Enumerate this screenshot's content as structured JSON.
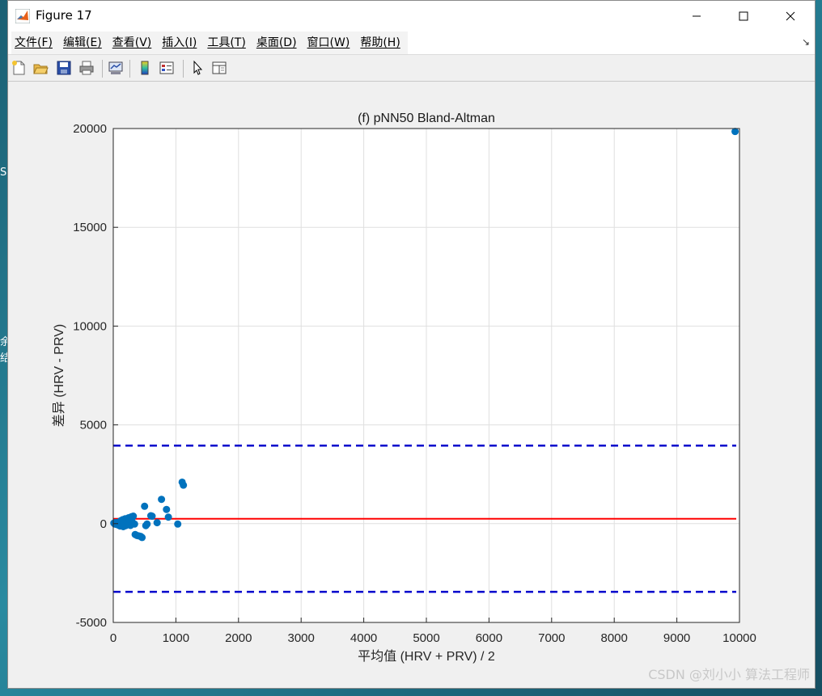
{
  "window": {
    "title": "Figure 17",
    "icon": "matlab-logo-icon"
  },
  "menu": [
    {
      "label": "文件(F)"
    },
    {
      "label": "编辑(E)"
    },
    {
      "label": "查看(V)"
    },
    {
      "label": "插入(I)"
    },
    {
      "label": "工具(T)"
    },
    {
      "label": "桌面(D)"
    },
    {
      "label": "窗口(W)"
    },
    {
      "label": "帮助(H)"
    }
  ],
  "menu_extra": "↘",
  "toolbar": [
    {
      "icon": "new-figure-icon"
    },
    {
      "icon": "open-file-icon"
    },
    {
      "icon": "save-icon"
    },
    {
      "icon": "print-icon"
    },
    {
      "icon": "link-plot-icon"
    },
    {
      "icon": "insert-colorbar-icon"
    },
    {
      "icon": "insert-legend-icon"
    },
    {
      "icon": "edit-plot-pointer-icon"
    },
    {
      "icon": "property-inspector-icon"
    }
  ],
  "desktop_fragments": [
    "S",
    "余",
    "结"
  ],
  "watermark": "CSDN @刘小小 算法工程师",
  "colors": {
    "points": "#0072BD",
    "mean_line": "#ff0000",
    "limit_lines": "#0000cc"
  },
  "chart_data": {
    "type": "scatter",
    "title": "(f) pNN50 Bland-Altman",
    "xlabel": "平均值 (HRV + PRV) / 2",
    "ylabel": "差异 (HRV - PRV)",
    "xlim": [
      0,
      10000
    ],
    "ylim": [
      -5000,
      20000
    ],
    "xticks": [
      0,
      1000,
      2000,
      3000,
      4000,
      5000,
      6000,
      7000,
      8000,
      9000,
      10000
    ],
    "yticks": [
      -5000,
      0,
      5000,
      10000,
      15000,
      20000
    ],
    "grid": true,
    "mean_diff": 250,
    "upper_loa": 3950,
    "lower_loa": -3450,
    "points": [
      {
        "x": 10,
        "y": 30
      },
      {
        "x": 25,
        "y": -20
      },
      {
        "x": 40,
        "y": 60
      },
      {
        "x": 55,
        "y": -40
      },
      {
        "x": 70,
        "y": 10
      },
      {
        "x": 85,
        "y": -80
      },
      {
        "x": 100,
        "y": 90
      },
      {
        "x": 110,
        "y": -120
      },
      {
        "x": 120,
        "y": 150
      },
      {
        "x": 135,
        "y": -60
      },
      {
        "x": 150,
        "y": 200
      },
      {
        "x": 160,
        "y": -150
      },
      {
        "x": 175,
        "y": 80
      },
      {
        "x": 190,
        "y": 250
      },
      {
        "x": 200,
        "y": -100
      },
      {
        "x": 215,
        "y": 120
      },
      {
        "x": 230,
        "y": -50
      },
      {
        "x": 245,
        "y": 300
      },
      {
        "x": 260,
        "y": 200
      },
      {
        "x": 275,
        "y": -90
      },
      {
        "x": 290,
        "y": 350
      },
      {
        "x": 300,
        "y": 100
      },
      {
        "x": 320,
        "y": 380
      },
      {
        "x": 340,
        "y": -20
      },
      {
        "x": 350,
        "y": -550
      },
      {
        "x": 380,
        "y": -600
      },
      {
        "x": 410,
        "y": -620
      },
      {
        "x": 440,
        "y": -650
      },
      {
        "x": 460,
        "y": -700
      },
      {
        "x": 500,
        "y": 880
      },
      {
        "x": 520,
        "y": -100
      },
      {
        "x": 540,
        "y": -20
      },
      {
        "x": 600,
        "y": 400
      },
      {
        "x": 620,
        "y": 380
      },
      {
        "x": 700,
        "y": 50
      },
      {
        "x": 770,
        "y": 1230
      },
      {
        "x": 850,
        "y": 720
      },
      {
        "x": 880,
        "y": 330
      },
      {
        "x": 1030,
        "y": -20
      },
      {
        "x": 1100,
        "y": 2100
      },
      {
        "x": 1120,
        "y": 1950
      },
      {
        "x": 9930,
        "y": 19850
      }
    ]
  }
}
